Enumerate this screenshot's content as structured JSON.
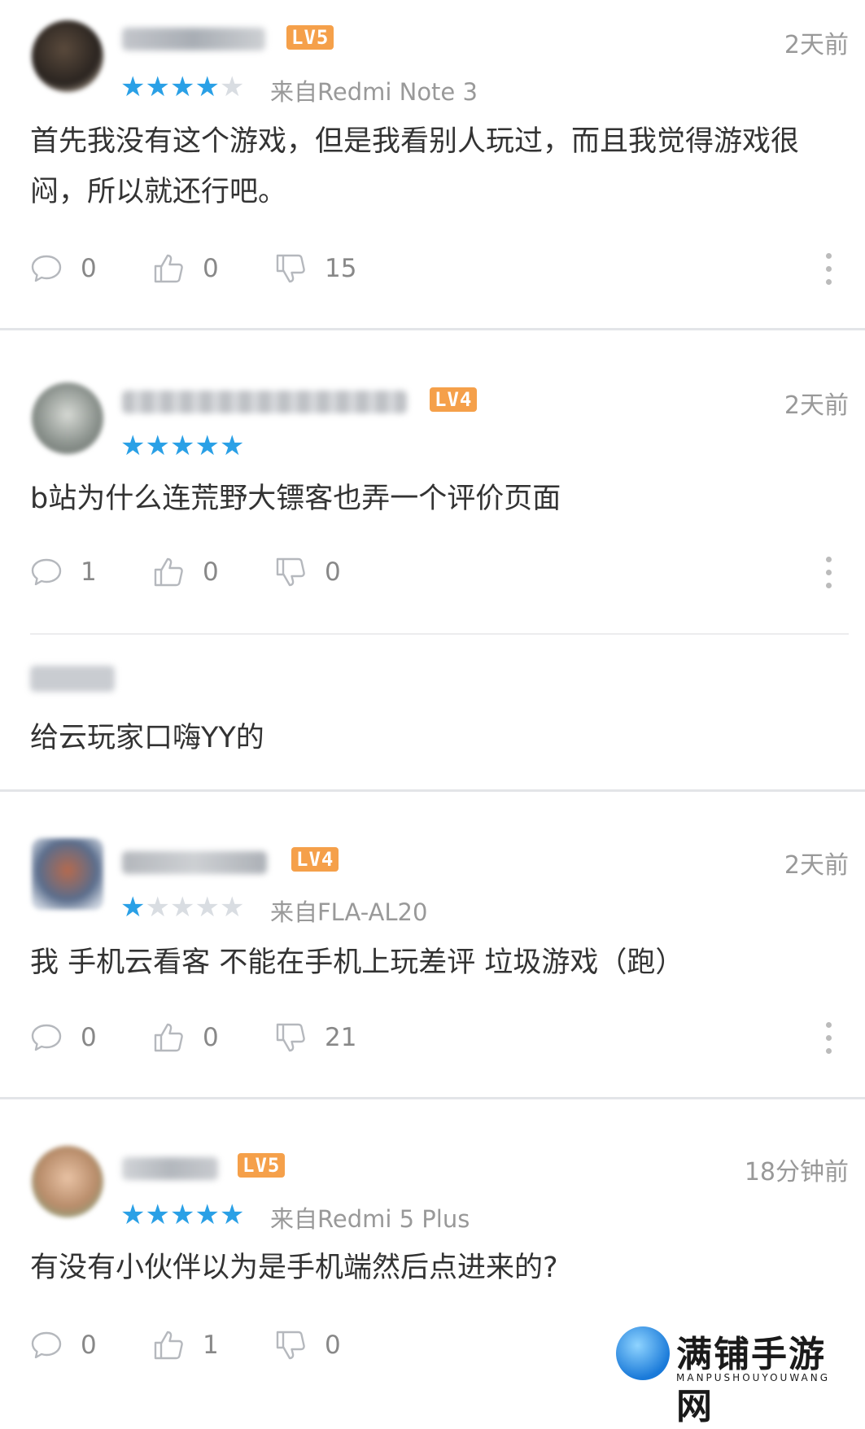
{
  "reviews": [
    {
      "level": "LV5",
      "time": "2天前",
      "rating": 4,
      "device": "来自Redmi Note 3",
      "content": "首先我没有这个游戏，但是我看别人玩过，而且我觉得游戏很闷，所以就还行吧。",
      "replies": "0",
      "likes": "0",
      "dislikes": "15"
    },
    {
      "level": "LV4",
      "time": "2天前",
      "rating": 5,
      "device": "",
      "content": "b站为什么连荒野大镖客也弄一个评价页面",
      "replies": "1",
      "likes": "0",
      "dislikes": "0",
      "reply_preview": "给云玩家口嗨YY的"
    },
    {
      "level": "LV4",
      "time": "2天前",
      "rating": 1,
      "device": "来自FLA-AL20",
      "content": "我 手机云看客 不能在手机上玩差评 垃圾游戏（跑）",
      "replies": "0",
      "likes": "0",
      "dislikes": "21"
    },
    {
      "level": "LV5",
      "time": "18分钟前",
      "rating": 5,
      "device": "来自Redmi 5 Plus",
      "content": "有没有小伙伴以为是手机端然后点进来的?",
      "replies": "0",
      "likes": "1",
      "dislikes": "0"
    }
  ],
  "icons": {
    "reply": "comment-bubble-icon",
    "like": "thumbs-up-icon",
    "dislike": "thumbs-down-icon",
    "more": "more-vertical-icon"
  },
  "colors": {
    "star_active": "#2aa0e6",
    "star_inactive": "#d9dde2",
    "level_badge": "#f5a04a"
  },
  "watermark": {
    "title": "满铺手游网",
    "subtitle": "MANPUSHOUYOUWANG"
  }
}
